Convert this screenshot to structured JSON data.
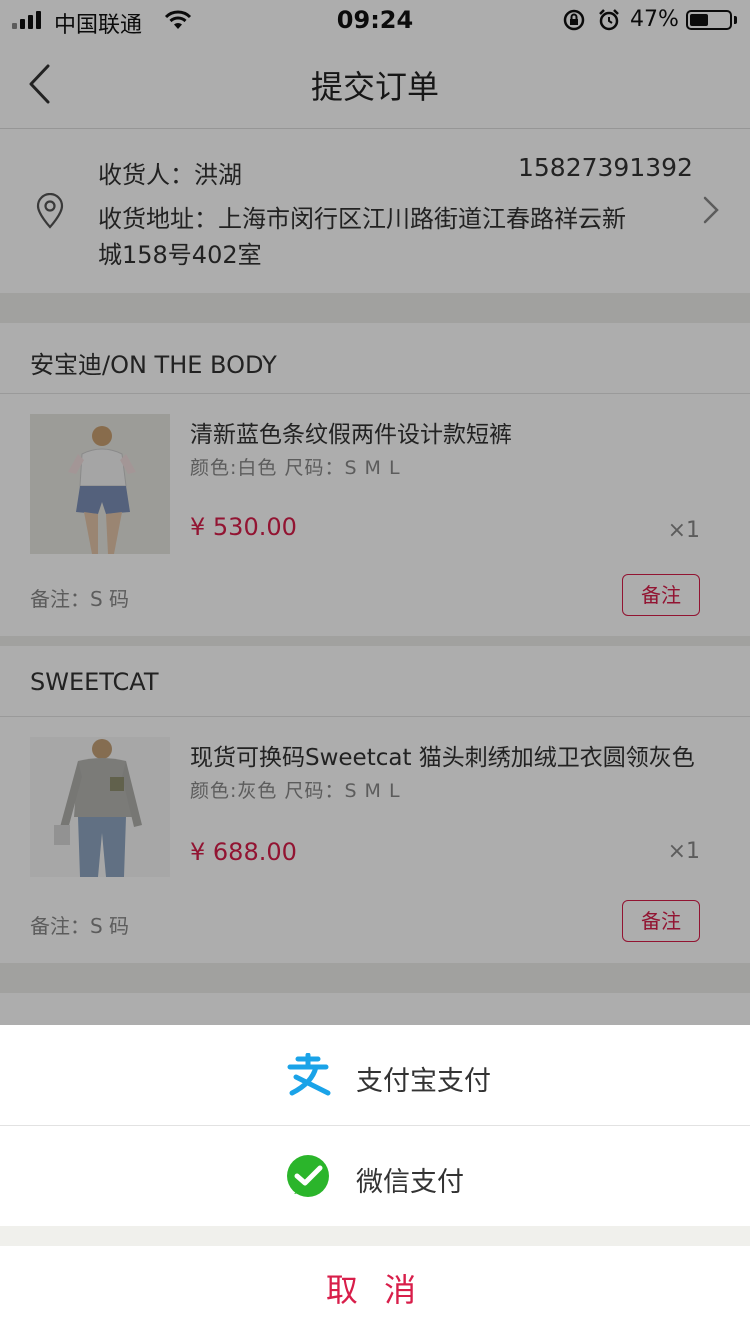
{
  "status_bar": {
    "carrier": "中国联通",
    "time": "09:24",
    "battery_percent": "47%",
    "battery_level": 0.47
  },
  "nav": {
    "title": "提交订单",
    "back_icon": "chevron-left-icon"
  },
  "address": {
    "recipient": "收货人：洪湖",
    "phone": "15827391392",
    "address_line1": "收货地址：上海市闵行区江川路街道江春路祥云新",
    "address_line2": "城158号402室",
    "icon": "location-pin-icon"
  },
  "stores": [
    {
      "name": "安宝迪/ON THE BODY",
      "product": {
        "name": "清新蓝色条纹假两件设计款短裤",
        "attrs": "颜色:白色  尺码：S M L",
        "price": "¥ 530.00",
        "qty": "×1"
      },
      "note": "备注：S 码",
      "note_button": "备注"
    },
    {
      "name": "SWEETCAT",
      "product": {
        "name": "现货可换码Sweetcat 猫头刺绣加绒卫衣圆领灰色",
        "attrs": "颜色:灰色  尺码：S M L",
        "price": "¥ 688.00",
        "qty": "×1"
      },
      "note": "备注：S 码",
      "note_button": "备注"
    }
  ],
  "payment_sheet": {
    "options": [
      {
        "label": "支付宝支付",
        "icon": "alipay-icon",
        "color": "#1aa3e8"
      },
      {
        "label": "微信支付",
        "icon": "wechat-icon",
        "color": "#2bb52b"
      }
    ],
    "cancel_label": "取 消"
  },
  "colors": {
    "accent": "#d81e4a",
    "overlay": "rgba(0,0,0,0.32)"
  }
}
